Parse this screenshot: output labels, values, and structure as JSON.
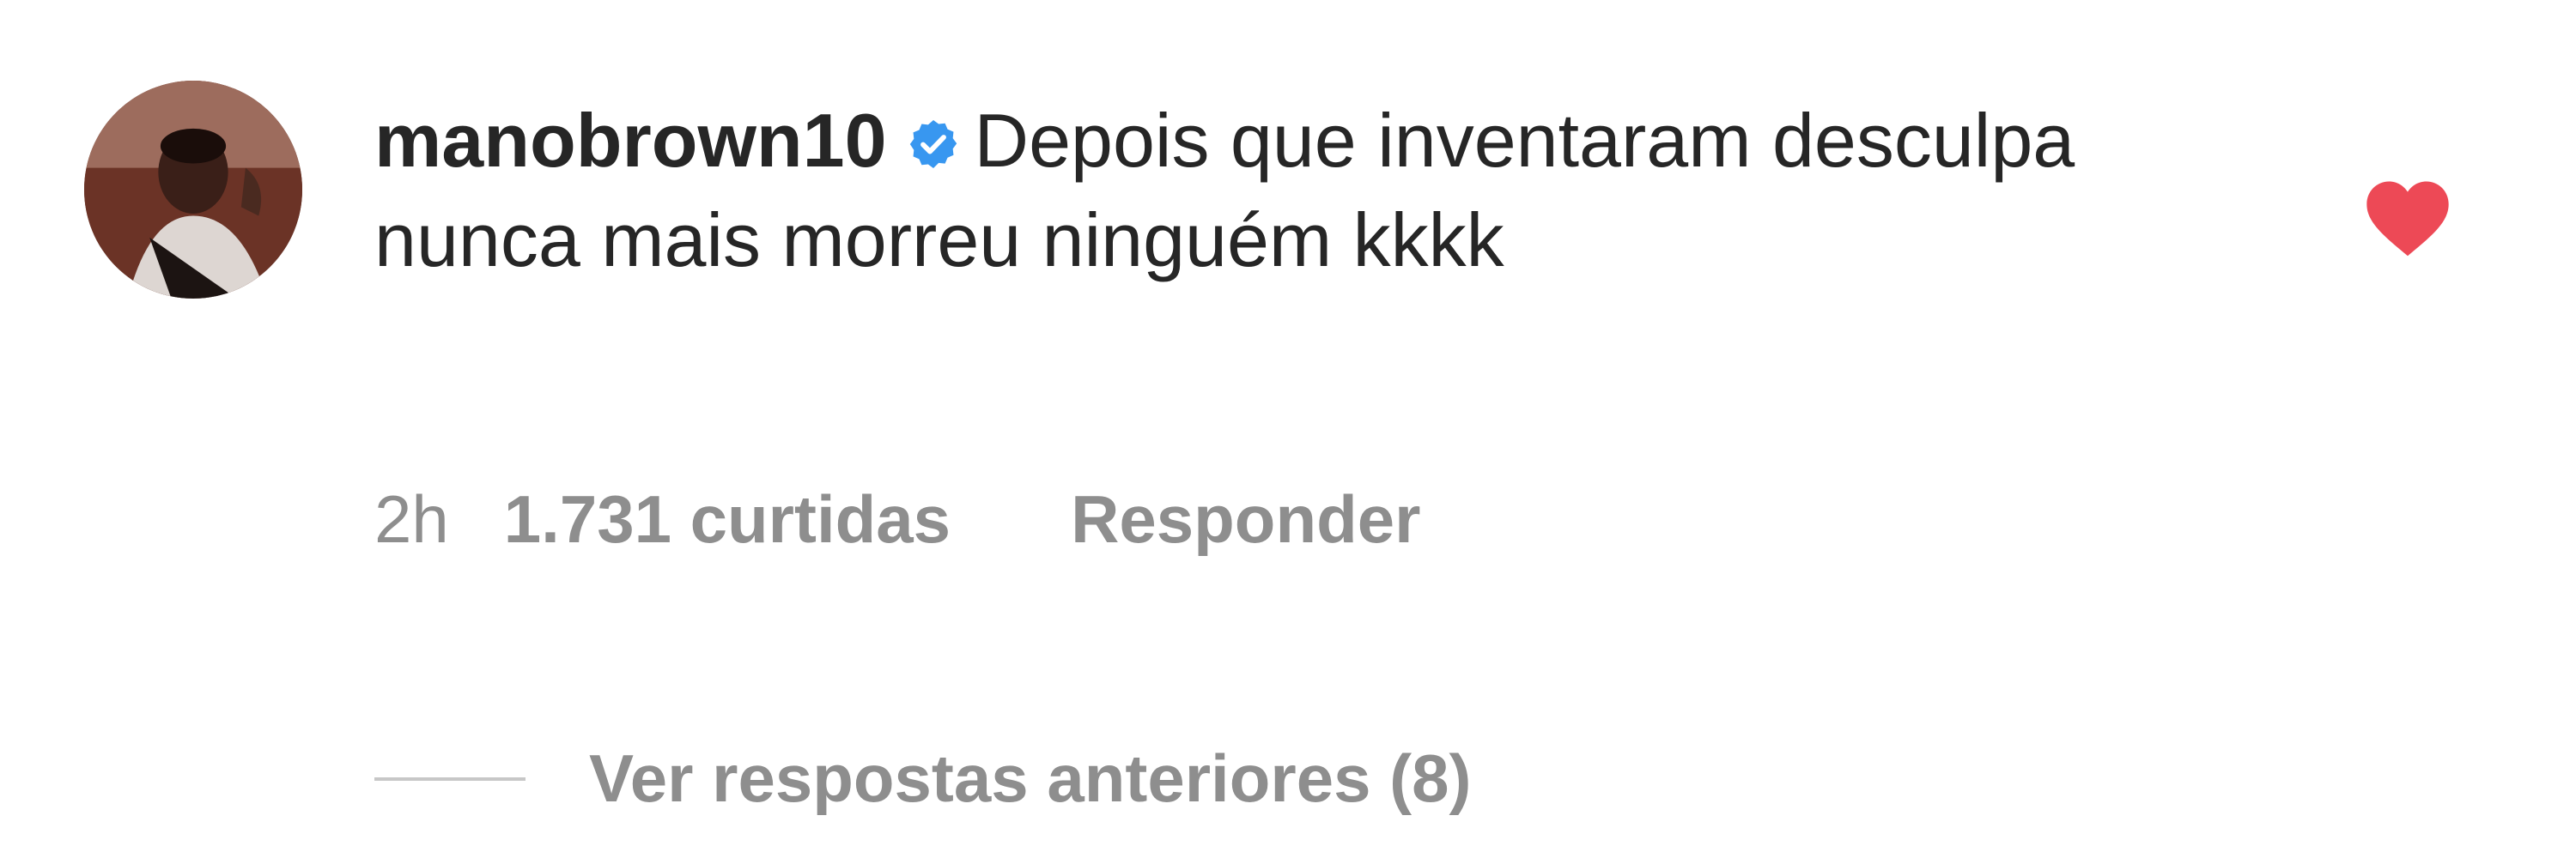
{
  "comment": {
    "username": "manobrown10",
    "verified_icon": "verified-badge-icon",
    "text": "Depois que inventaram desculpa nunca mais morreu ninguém kkkk",
    "time": "2h",
    "likes": "1.731 curtidas",
    "reply_label": "Responder",
    "liked": true,
    "heart_icon": "heart-icon",
    "view_replies": "Ver respostas anteriores (8)"
  },
  "colors": {
    "text": "#262626",
    "secondary": "#8e8e8e",
    "verified": "#3897f0",
    "heart": "#ed4956"
  }
}
